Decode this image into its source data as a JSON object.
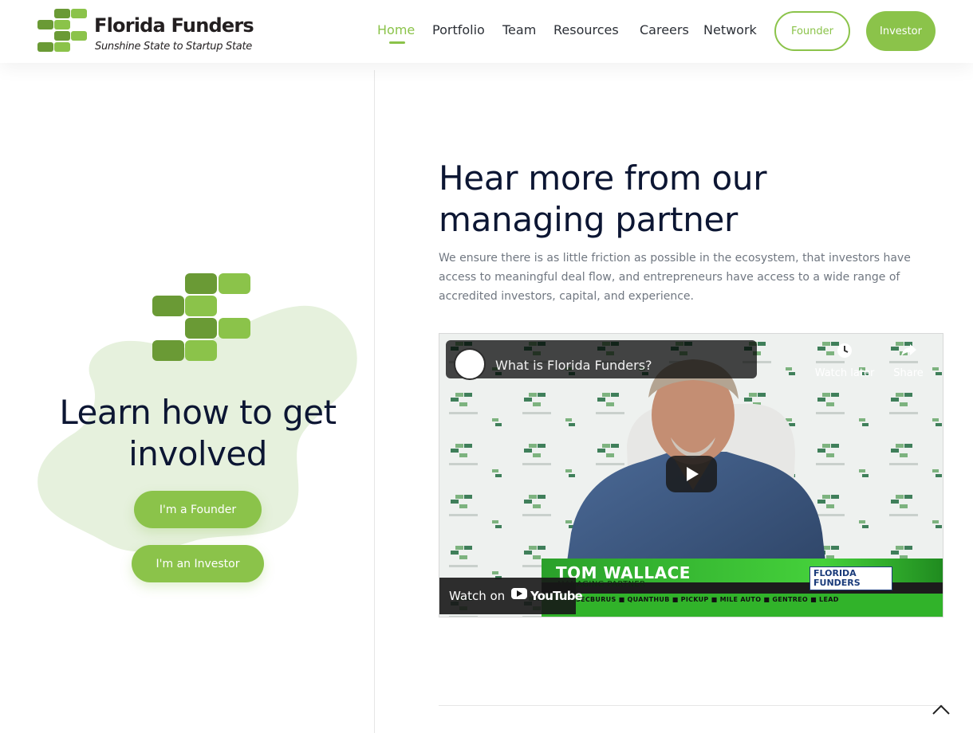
{
  "brand": {
    "name": "Florida Funders",
    "tagline": "Sunshine State to Startup State",
    "accent_color": "#8bc34a",
    "dark_color": "#0c1633"
  },
  "nav": {
    "items": [
      {
        "label": "Home",
        "active": true
      },
      {
        "label": "Portfolio"
      },
      {
        "label": "Team"
      },
      {
        "label": "Resources"
      },
      {
        "label": "Careers"
      },
      {
        "label": "Network"
      }
    ],
    "founder_button": "Founder",
    "investor_button": "Investor"
  },
  "left": {
    "title_line1": "Learn how to get",
    "title_line2": "involved",
    "founder_cta": "I'm a Founder",
    "investor_cta": "I'm an Investor"
  },
  "right": {
    "title_line1": "Hear more from our",
    "title_line2": "managing partner",
    "description": "We ensure there is as little friction as possible in the ecosystem, that investors have access to meaningful deal flow, and entrepreneurs have access to a wide range of accredited investors, capital, and experience."
  },
  "video": {
    "title": "What is Florida Funders?",
    "watch_later": "Watch later",
    "share": "Share",
    "watch_on": "Watch on",
    "youtube": "YouTube",
    "speaker_name": "TOM WALLACE",
    "speaker_role": "MANAGING PARTNER",
    "overlay_brand_1": "FLORIDA",
    "overlay_brand_2": "FUNDERS",
    "ticker": "SECBURUS ■ QUANTHUB ■ PICKUP ■ MILE AUTO ■ GENTREO ■ LEAD"
  }
}
